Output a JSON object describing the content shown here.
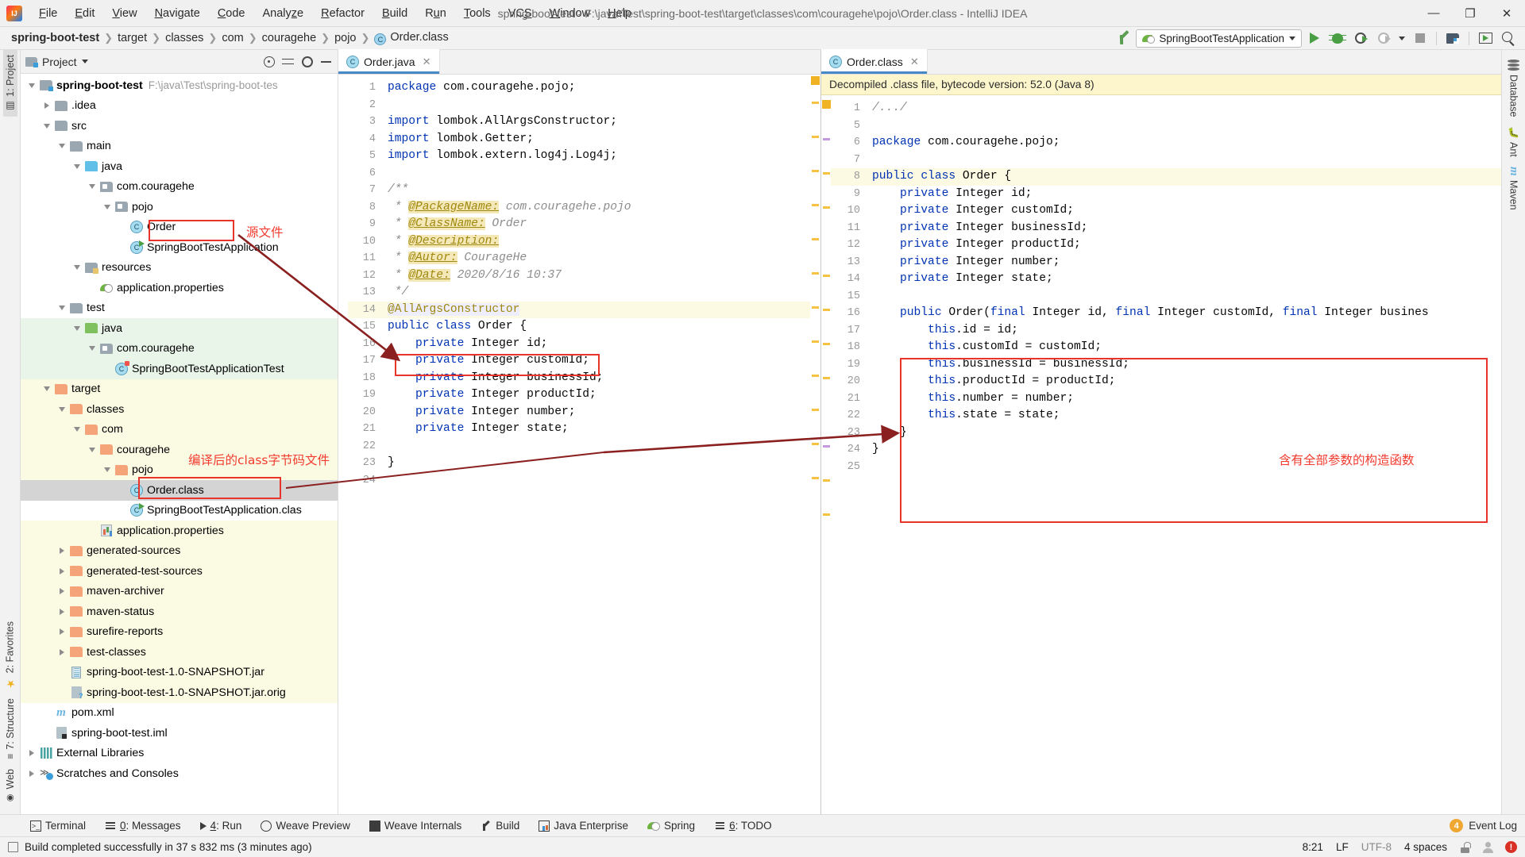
{
  "titlebar": {
    "menus": [
      "File",
      "Edit",
      "View",
      "Navigate",
      "Code",
      "Analyze",
      "Refactor",
      "Build",
      "Run",
      "Tools",
      "VCS",
      "Window",
      "Help"
    ],
    "window_title": "spring-boot-test - F:\\java\\Test\\spring-boot-test\\target\\classes\\com\\couragehe\\pojo\\Order.class - IntelliJ IDEA",
    "minimize": "—",
    "maximize": "❐",
    "close": "✕"
  },
  "navbar": {
    "crumbs": [
      "spring-boot-test",
      "target",
      "classes",
      "com",
      "couragehe",
      "pojo",
      "Order.class"
    ],
    "crumb_icon": "C",
    "run_config": "SpringBootTestApplication"
  },
  "project_panel": {
    "title": "Project",
    "tree": [
      {
        "depth": 0,
        "twist": "open",
        "icon": "folder-mod",
        "label": "spring-boot-test",
        "bold": true,
        "path": "F:\\java\\Test\\spring-boot-tes",
        "bg": "none"
      },
      {
        "depth": 1,
        "twist": "closed",
        "icon": "folder",
        "label": ".idea",
        "bg": "none"
      },
      {
        "depth": 1,
        "twist": "open",
        "icon": "folder",
        "label": "src",
        "bg": "none"
      },
      {
        "depth": 2,
        "twist": "open",
        "icon": "folder",
        "label": "main",
        "bg": "none"
      },
      {
        "depth": 3,
        "twist": "open",
        "icon": "folder-blue",
        "label": "java",
        "bg": "none"
      },
      {
        "depth": 4,
        "twist": "open",
        "icon": "package",
        "label": "com.couragehe",
        "bg": "none"
      },
      {
        "depth": 5,
        "twist": "open",
        "icon": "package",
        "label": "pojo",
        "bg": "none"
      },
      {
        "depth": 6,
        "twist": "none",
        "icon": "class",
        "label": "Order",
        "bg": "none"
      },
      {
        "depth": 6,
        "twist": "none",
        "icon": "class-run",
        "label": "SpringBootTestApplication",
        "bg": "none"
      },
      {
        "depth": 3,
        "twist": "open",
        "icon": "folder-res",
        "label": "resources",
        "bg": "none"
      },
      {
        "depth": 4,
        "twist": "none",
        "icon": "spring",
        "label": "application.properties",
        "bg": "none"
      },
      {
        "depth": 2,
        "twist": "open",
        "icon": "folder",
        "label": "test",
        "bg": "none"
      },
      {
        "depth": 3,
        "twist": "open",
        "icon": "folder-green",
        "label": "java",
        "bg": "test"
      },
      {
        "depth": 4,
        "twist": "open",
        "icon": "package",
        "label": "com.couragehe",
        "bg": "test"
      },
      {
        "depth": 5,
        "twist": "none",
        "icon": "class-test",
        "label": "SpringBootTestApplicationTest",
        "bg": "test"
      },
      {
        "depth": 1,
        "twist": "open",
        "icon": "folder-orange",
        "label": "target",
        "bg": "target"
      },
      {
        "depth": 2,
        "twist": "open",
        "icon": "folder-orange",
        "label": "classes",
        "bg": "target"
      },
      {
        "depth": 3,
        "twist": "open",
        "icon": "folder-orange",
        "label": "com",
        "bg": "target"
      },
      {
        "depth": 4,
        "twist": "open",
        "icon": "folder-orange",
        "label": "couragehe",
        "bg": "target"
      },
      {
        "depth": 5,
        "twist": "open",
        "icon": "folder-orange",
        "label": "pojo",
        "bg": "target"
      },
      {
        "depth": 6,
        "twist": "none",
        "icon": "class",
        "label": "Order.class",
        "bg": "sel"
      },
      {
        "depth": 6,
        "twist": "none",
        "icon": "class-run",
        "label": "SpringBootTestApplication.clas",
        "bg": "none"
      },
      {
        "depth": 4,
        "twist": "none",
        "icon": "props",
        "label": "application.properties",
        "bg": "target"
      },
      {
        "depth": 2,
        "twist": "closed",
        "icon": "folder-orange",
        "label": "generated-sources",
        "bg": "target"
      },
      {
        "depth": 2,
        "twist": "closed",
        "icon": "folder-orange",
        "label": "generated-test-sources",
        "bg": "target"
      },
      {
        "depth": 2,
        "twist": "closed",
        "icon": "folder-orange",
        "label": "maven-archiver",
        "bg": "target"
      },
      {
        "depth": 2,
        "twist": "closed",
        "icon": "folder-orange",
        "label": "maven-status",
        "bg": "target"
      },
      {
        "depth": 2,
        "twist": "closed",
        "icon": "folder-orange",
        "label": "surefire-reports",
        "bg": "target"
      },
      {
        "depth": 2,
        "twist": "closed",
        "icon": "folder-orange",
        "label": "test-classes",
        "bg": "target"
      },
      {
        "depth": 2,
        "twist": "none",
        "icon": "jar",
        "label": "spring-boot-test-1.0-SNAPSHOT.jar",
        "bg": "target"
      },
      {
        "depth": 2,
        "twist": "none",
        "icon": "jarorig",
        "label": "spring-boot-test-1.0-SNAPSHOT.jar.orig",
        "bg": "target"
      },
      {
        "depth": 1,
        "twist": "none",
        "icon": "maven",
        "label": "pom.xml",
        "bg": "none"
      },
      {
        "depth": 1,
        "twist": "none",
        "icon": "iml",
        "label": "spring-boot-test.iml",
        "bg": "none"
      },
      {
        "depth": 0,
        "twist": "closed",
        "icon": "lib",
        "label": "External Libraries",
        "bg": "none"
      },
      {
        "depth": 0,
        "twist": "closed",
        "icon": "scratch",
        "label": "Scratches and Consoles",
        "bg": "none"
      }
    ]
  },
  "left_strip": [
    {
      "label": "1: Project",
      "icon": "▤",
      "selected": true
    },
    {
      "label": "2: Favorites",
      "icon": "★",
      "selected": false
    },
    {
      "label": "7: Structure",
      "icon": "≡",
      "selected": false
    },
    {
      "label": "Web",
      "icon": "⊕",
      "selected": false
    }
  ],
  "right_strip": [
    {
      "label": "Database",
      "icon": "db"
    },
    {
      "label": "Ant",
      "icon": "ant"
    },
    {
      "label": "Maven",
      "icon": "m"
    }
  ],
  "editor_left": {
    "tab": "Order.java",
    "tab_icon": "C",
    "close": "✕",
    "lines": [
      {
        "n": "1",
        "text": "package com.couragehe.pojo;"
      },
      {
        "n": "2",
        "text": ""
      },
      {
        "n": "3",
        "text": "import lombok.AllArgsConstructor;"
      },
      {
        "n": "4",
        "text": "import lombok.Getter;"
      },
      {
        "n": "5",
        "text": "import lombok.extern.log4j.Log4j;"
      },
      {
        "n": "6",
        "text": ""
      },
      {
        "n": "7",
        "text": "/**"
      },
      {
        "n": "8",
        "text": " * @PackageName: com.couragehe.pojo"
      },
      {
        "n": "9",
        "text": " * @ClassName: Order"
      },
      {
        "n": "10",
        "text": " * @Description:"
      },
      {
        "n": "11",
        "text": " * @Autor: CourageHe"
      },
      {
        "n": "12",
        "text": " * @Date: 2020/8/16 10:37"
      },
      {
        "n": "13",
        "text": " */"
      },
      {
        "n": "14",
        "text": "@AllArgsConstructor"
      },
      {
        "n": "15",
        "text": "public class Order {"
      },
      {
        "n": "16",
        "text": "    private Integer id;"
      },
      {
        "n": "17",
        "text": "    private Integer customId;"
      },
      {
        "n": "18",
        "text": "    private Integer businessId;"
      },
      {
        "n": "19",
        "text": "    private Integer productId;"
      },
      {
        "n": "20",
        "text": "    private Integer number;"
      },
      {
        "n": "21",
        "text": "    private Integer state;"
      },
      {
        "n": "22",
        "text": ""
      },
      {
        "n": "23",
        "text": "}"
      },
      {
        "n": "24",
        "text": ""
      }
    ]
  },
  "editor_right": {
    "tab": "Order.class",
    "tab_icon": "C",
    "close": "✕",
    "notice": "Decompiled .class file, bytecode version: 52.0 (Java 8)",
    "lines": [
      {
        "n": "1",
        "text": "/.../"
      },
      {
        "n": "5",
        "text": ""
      },
      {
        "n": "6",
        "text": "package com.couragehe.pojo;"
      },
      {
        "n": "7",
        "text": ""
      },
      {
        "n": "8",
        "text": "public class Order {"
      },
      {
        "n": "9",
        "text": "    private Integer id;"
      },
      {
        "n": "10",
        "text": "    private Integer customId;"
      },
      {
        "n": "11",
        "text": "    private Integer businessId;"
      },
      {
        "n": "12",
        "text": "    private Integer productId;"
      },
      {
        "n": "13",
        "text": "    private Integer number;"
      },
      {
        "n": "14",
        "text": "    private Integer state;"
      },
      {
        "n": "15",
        "text": ""
      },
      {
        "n": "16",
        "text": "    public Order(final Integer id, final Integer customId, final Integer busines"
      },
      {
        "n": "17",
        "text": "        this.id = id;"
      },
      {
        "n": "18",
        "text": "        this.customId = customId;"
      },
      {
        "n": "19",
        "text": "        this.businessId = businessId;"
      },
      {
        "n": "20",
        "text": "        this.productId = productId;"
      },
      {
        "n": "21",
        "text": "        this.number = number;"
      },
      {
        "n": "22",
        "text": "        this.state = state;"
      },
      {
        "n": "23",
        "text": "    }"
      },
      {
        "n": "24",
        "text": "}"
      },
      {
        "n": "25",
        "text": ""
      }
    ]
  },
  "annotations": {
    "source_file_label": "源文件",
    "class_file_label": "编译后的class字节码文件",
    "constructor_label": "含有全部参数的构造函数",
    "box_color": "#e8342a",
    "text_color": "#f23a2e",
    "arrow_color": "#8b2020"
  },
  "toolwindow_bar": {
    "items": [
      {
        "label": "Terminal",
        "icon": "term",
        "mnemonic": ""
      },
      {
        "label": "0: Messages",
        "icon": "msg",
        "mnemonic": "0"
      },
      {
        "label": "4: Run",
        "icon": "runtri",
        "mnemonic": "4"
      },
      {
        "label": "Weave Preview",
        "icon": "weave",
        "mnemonic": ""
      },
      {
        "label": "Weave Internals",
        "icon": "wint",
        "mnemonic": ""
      },
      {
        "label": "Build",
        "icon": "build",
        "mnemonic": ""
      },
      {
        "label": "Java Enterprise",
        "icon": "jee",
        "mnemonic": ""
      },
      {
        "label": "Spring",
        "icon": "spring",
        "mnemonic": ""
      },
      {
        "label": "6: TODO",
        "icon": "todo",
        "mnemonic": "6"
      }
    ],
    "event_log": "Event Log",
    "event_count": "4"
  },
  "statusbar": {
    "message": "Build completed successfully in 37 s 832 ms (3 minutes ago)",
    "caret": "8:21",
    "line_sep": "LF",
    "encoding": "UTF-8",
    "indent": "4 spaces"
  }
}
